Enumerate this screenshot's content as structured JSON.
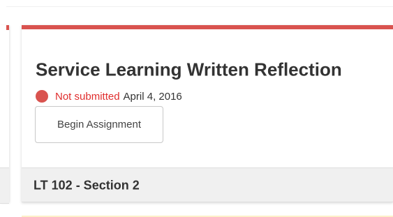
{
  "assignment": {
    "title": "Service Learning Written Reflection",
    "status_text": "Not submitted",
    "due_date": "April 4, 2016",
    "begin_button_label": "Begin Assignment",
    "course_section": "LT 102 - Section 2"
  },
  "colors": {
    "accent": "#d9534f",
    "status_text": "#e02e2e",
    "footer_bg": "#f0f0f0"
  }
}
